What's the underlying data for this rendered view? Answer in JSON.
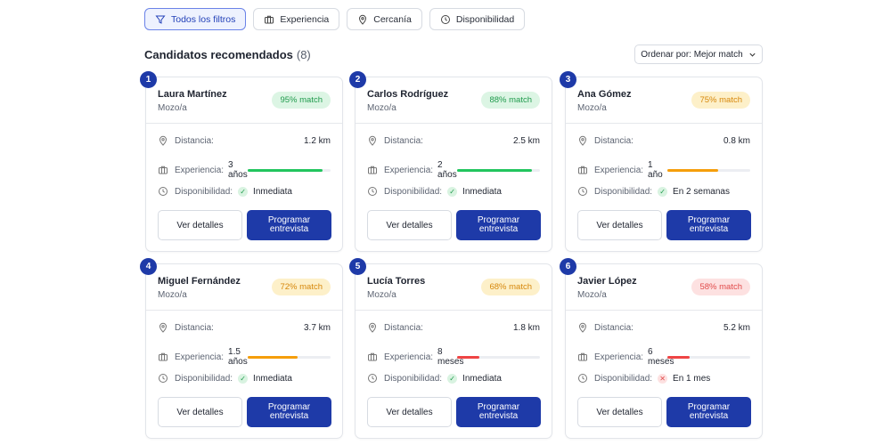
{
  "filters": [
    {
      "label": "Todos los filtros",
      "icon": "filter-icon",
      "active": true
    },
    {
      "label": "Experiencia",
      "icon": "briefcase-icon",
      "active": false
    },
    {
      "label": "Cercanía",
      "icon": "location-pin-icon",
      "active": false
    },
    {
      "label": "Disponibilidad",
      "icon": "clock-icon",
      "active": false
    }
  ],
  "section": {
    "title": "Candidatos recomendados",
    "count": "(8)"
  },
  "sort": {
    "label": "Ordenar por: Mejor match"
  },
  "labels": {
    "distance": "Distancia:",
    "experience": "Experiencia:",
    "availability": "Disponibilidad:",
    "details_button": "Ver detalles",
    "schedule_button": "Programar entrevista"
  },
  "colors": {
    "primary": "#1e3aa8",
    "high": "#22c55e",
    "mid": "#f59e0b",
    "low": "#ef4444"
  },
  "candidates": [
    {
      "number": "1",
      "name": "Laura Martínez",
      "role": "Mozo/a",
      "match": "95% match",
      "level": "high",
      "distance": "1.2 km",
      "experience": "3 años",
      "exp_fraction": 0.9,
      "availability": "Inmediata",
      "available": true
    },
    {
      "number": "2",
      "name": "Carlos Rodríguez",
      "role": "Mozo/a",
      "match": "88% match",
      "level": "high",
      "distance": "2.5 km",
      "experience": "2 años",
      "exp_fraction": 0.9,
      "availability": "Inmediata",
      "available": true
    },
    {
      "number": "3",
      "name": "Ana Gómez",
      "role": "Mozo/a",
      "match": "75% match",
      "level": "mid",
      "distance": "0.8 km",
      "experience": "1 año",
      "exp_fraction": 0.61,
      "availability": "En 2 semanas",
      "available": true
    },
    {
      "number": "4",
      "name": "Miguel Fernández",
      "role": "Mozo/a",
      "match": "72% match",
      "level": "mid",
      "distance": "3.7 km",
      "experience": "1.5 años",
      "exp_fraction": 0.6,
      "availability": "Inmediata",
      "available": true
    },
    {
      "number": "5",
      "name": "Lucía Torres",
      "role": "Mozo/a",
      "match": "68% match",
      "level": "low-mid",
      "distance": "1.8 km",
      "experience": "8 meses",
      "exp_fraction": 0.27,
      "availability": "Inmediata",
      "available": true
    },
    {
      "number": "6",
      "name": "Javier López",
      "role": "Mozo/a",
      "match": "58% match",
      "level": "low",
      "distance": "5.2 km",
      "experience": "6 meses",
      "exp_fraction": 0.27,
      "availability": "En 1 mes",
      "available": false
    }
  ]
}
